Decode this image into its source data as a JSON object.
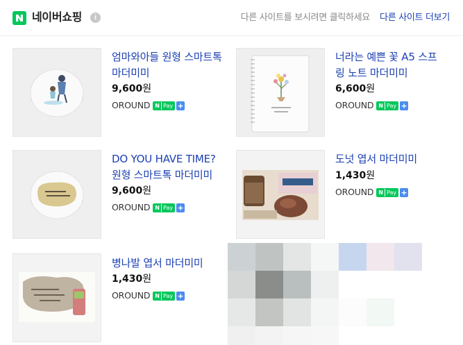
{
  "header": {
    "brand": "네이버쇼핑",
    "info_icon": "i",
    "notice": "다른 사이트를 보시려면 클릭하세요",
    "more_link": "다른 사이트 더보기"
  },
  "npay": {
    "n": "N",
    "pay": "Pay",
    "plus": "+"
  },
  "products": [
    {
      "title": "엄마와아들 원형 스마트톡 마더미미",
      "price": "9,600",
      "unit": "원",
      "mall": "OROUND"
    },
    {
      "title": "너라는 예쁜 꽃 A5 스프링 노트 마더미미",
      "price": "6,600",
      "unit": "원",
      "mall": "OROUND"
    },
    {
      "title": "DO YOU HAVE TIME? 원형 스마트톡 마더미미",
      "price": "9,600",
      "unit": "원",
      "mall": "OROUND"
    },
    {
      "title": "도넛 엽서 마더미미",
      "price": "1,430",
      "unit": "원",
      "mall": "OROUND"
    },
    {
      "title": "병나발 엽서 마더미미",
      "price": "1,430",
      "unit": "원",
      "mall": "OROUND"
    }
  ],
  "colors": {
    "brand_green": "#03c75a",
    "link_blue": "#1a3fb2",
    "npay_plus_blue": "#4a8cf0"
  }
}
